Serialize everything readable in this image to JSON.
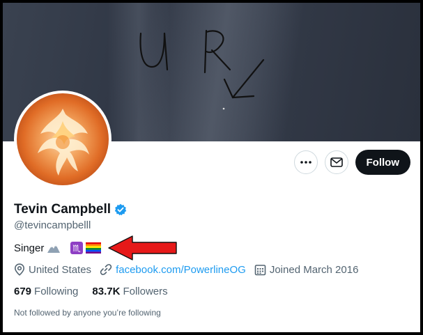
{
  "profile": {
    "name": "Tevin Campbell",
    "handle": "@tevincampbelll",
    "bio_text": "Singer",
    "location": "United States",
    "link": "facebook.com/PowerlineOG",
    "joined": "Joined March 2016",
    "following_count": "679",
    "following_label": "Following",
    "followers_count": "83.7K",
    "followers_label": "Followers",
    "followed_by": "Not followed by anyone you’re following"
  },
  "actions": {
    "more_icon": "more-icon",
    "message_icon": "mail-icon",
    "follow_label": "Follow"
  },
  "banner_annotation": {
    "text": "U R"
  },
  "colors": {
    "accent": "#1d9bf0",
    "text_primary": "#0f1419",
    "text_secondary": "#536471",
    "follow_bg": "#0f1419",
    "annotation_arrow": "#e61919"
  }
}
